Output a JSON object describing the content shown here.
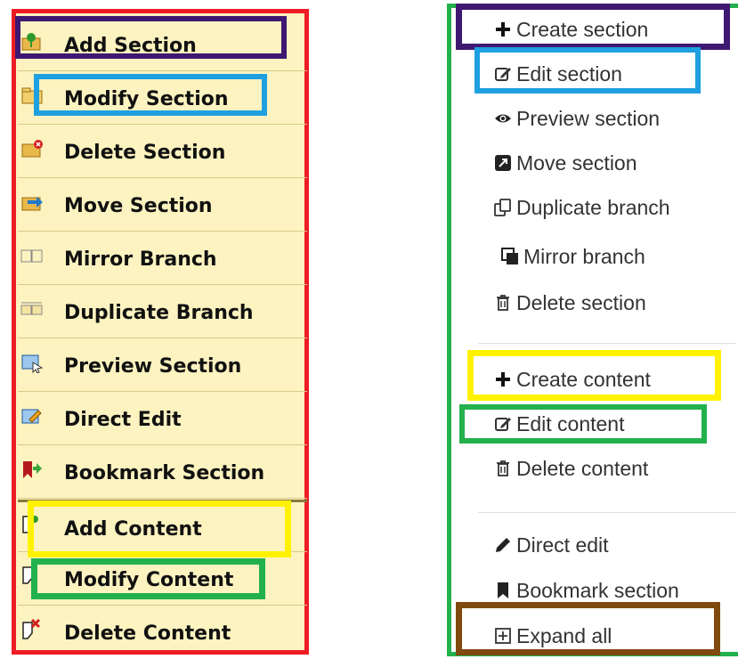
{
  "old_menu": {
    "items": [
      {
        "label": "Add Section",
        "icon": "add-section-icon"
      },
      {
        "label": "Modify Section",
        "icon": "modify-section-icon"
      },
      {
        "label": "Delete Section",
        "icon": "delete-section-icon"
      },
      {
        "label": "Move Section",
        "icon": "move-section-icon"
      },
      {
        "label": "Mirror Branch",
        "icon": "mirror-branch-icon"
      },
      {
        "label": "Duplicate Branch",
        "icon": "duplicate-branch-icon"
      },
      {
        "label": "Preview Section",
        "icon": "preview-section-icon"
      },
      {
        "label": "Direct Edit",
        "icon": "direct-edit-icon"
      },
      {
        "label": "Bookmark Section",
        "icon": "bookmark-section-icon"
      },
      {
        "label": "Add Content",
        "icon": "add-content-icon"
      },
      {
        "label": "Modify Content",
        "icon": "modify-content-icon"
      },
      {
        "label": "Delete Content",
        "icon": "delete-content-icon"
      }
    ]
  },
  "new_menu": {
    "items": [
      {
        "label": "Create section",
        "icon": "plus-icon"
      },
      {
        "label": "Edit section",
        "icon": "edit-icon"
      },
      {
        "label": "Preview section",
        "icon": "eye-icon"
      },
      {
        "label": "Move section",
        "icon": "move-icon"
      },
      {
        "label": "Duplicate branch",
        "icon": "copy-icon"
      },
      {
        "label": "Mirror branch",
        "icon": "mirror-icon"
      },
      {
        "label": "Delete section",
        "icon": "trash-icon"
      },
      {
        "label": "Create content",
        "icon": "plus-icon"
      },
      {
        "label": "Edit content",
        "icon": "edit-icon"
      },
      {
        "label": "Delete content",
        "icon": "trash-icon"
      },
      {
        "label": "Direct edit",
        "icon": "pencil-icon"
      },
      {
        "label": "Bookmark section",
        "icon": "bookmark-icon"
      },
      {
        "label": "Expand all",
        "icon": "plus-square-icon"
      }
    ]
  },
  "colors": {
    "old_menu_border": "#ed1c24",
    "new_menu_border": "#22b14c",
    "purple_highlight": "#3f1872",
    "blue_highlight": "#1fa0e0",
    "yellow_highlight": "#fff200",
    "green_highlight": "#22b14c",
    "brown_highlight": "#7f4a0f",
    "old_menu_background": "#fdf3c0"
  }
}
